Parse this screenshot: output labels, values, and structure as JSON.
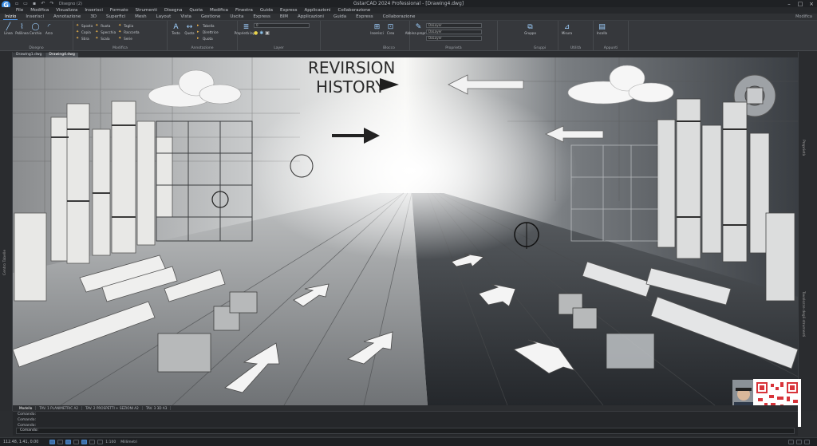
{
  "window": {
    "title": "GstarCAD 2024 Professional - [Drawing4.dwg]",
    "quick_access_search": "Disegno (2)"
  },
  "menubar": [
    "File",
    "Modifica",
    "Visualizza",
    "Inserisci",
    "Formato",
    "Strumenti",
    "Disegna",
    "Quota",
    "Modifica",
    "Finestra",
    "Guida",
    "Express",
    "Applicazioni",
    "Collaborazione"
  ],
  "ribbon_tabs": [
    "Inizio",
    "Inserisci",
    "Annotazione",
    "3D",
    "Superfici",
    "Mesh",
    "Layout",
    "Vista",
    "Gestione",
    "Uscita",
    "Express",
    "BIM",
    "Applicazioni",
    "Guida",
    "Express",
    "Collaborazione"
  ],
  "ribbon_active_tab": 0,
  "workspace": "Modifica",
  "ribbon_groups": {
    "draw": {
      "title": "Disegno",
      "big": [
        {
          "label": "Linea",
          "icon": "line-icon"
        },
        {
          "label": "Polilinea",
          "icon": "polyline-icon"
        },
        {
          "label": "Cerchio",
          "icon": "circle-icon"
        },
        {
          "label": "Arco",
          "icon": "arc-icon"
        }
      ]
    },
    "modify": {
      "title": "Modifica",
      "rows": [
        [
          "Sposta",
          "Ruota",
          "Taglia"
        ],
        [
          "Copia",
          "Specchia",
          "Raccorda"
        ],
        [
          "Stira",
          "Scala",
          "Serie"
        ]
      ]
    },
    "annotation": {
      "title": "Annotazione",
      "big": [
        {
          "label": "Testo",
          "icon": "text-icon"
        },
        {
          "label": "Quota",
          "icon": "dimension-icon"
        }
      ],
      "small": [
        "Tabella",
        "Direttrice",
        "Quota"
      ]
    },
    "layers": {
      "title": "Layer",
      "big": [
        {
          "label": "Proprietà layer",
          "icon": "layers-icon"
        }
      ],
      "combo": "0"
    },
    "block": {
      "title": "Blocco",
      "big": [
        {
          "label": "Inserisci",
          "icon": "insert-block-icon"
        },
        {
          "label": "Crea",
          "icon": "create-block-icon"
        }
      ]
    },
    "properties": {
      "title": "Proprietà",
      "big": [
        {
          "label": "Abbina proprietà",
          "icon": "match-properties-icon"
        }
      ],
      "combos": [
        "DaLayer",
        "DaLayer",
        "DaLayer"
      ]
    },
    "groups": {
      "title": "Gruppi",
      "big": [
        {
          "label": "Gruppo",
          "icon": "group-icon"
        }
      ]
    },
    "utility": {
      "title": "Utilità",
      "big": [
        {
          "label": "Misura",
          "icon": "measure-icon"
        }
      ]
    },
    "clipboard": {
      "title": "Appunti",
      "big": [
        {
          "label": "Incolla",
          "icon": "paste-icon"
        }
      ]
    }
  },
  "doc_tabs": [
    "Drawing1.dwg",
    "Drawing4.dwg"
  ],
  "doc_active_tab": 1,
  "left_palette_label": "Centro Tabelle",
  "right_palette_labels": [
    "Proprietà",
    "Tavolozze degli strumenti"
  ],
  "canvas": {
    "heading_line1": "REVIRSION",
    "heading_line2": "HISTORY"
  },
  "layout_tabs": [
    "Modello",
    "TAV. 1 PLANIMETRIC A2",
    "TAV. 2 PROSPETTI + SEZIONI A2",
    "TAV. 3 3D A3"
  ],
  "layout_active_tab": 0,
  "command_history": [
    "Comando:",
    "Comando:",
    "Comando:"
  ],
  "command_input": "Comando:",
  "status": {
    "coords": "112.48, 1.41, 0.00",
    "scale": "1:100",
    "unit": "Millimetri"
  },
  "colors": {
    "accent": "#3a8ee6",
    "ribbon_bg": "#36383c",
    "canvas_light": "#eef0f1",
    "canvas_dark": "#2c2f33"
  }
}
